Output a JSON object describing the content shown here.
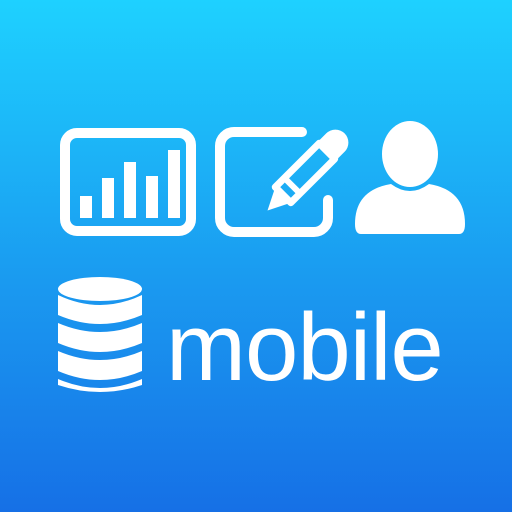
{
  "app_icon": {
    "wordmark": "mobile",
    "icons": [
      "bar-chart-icon",
      "edit-icon",
      "user-icon",
      "database-icon"
    ],
    "colors": {
      "gradient_top": "#1ed1ff",
      "gradient_bottom": "#1670e6",
      "foreground": "#ffffff"
    }
  }
}
